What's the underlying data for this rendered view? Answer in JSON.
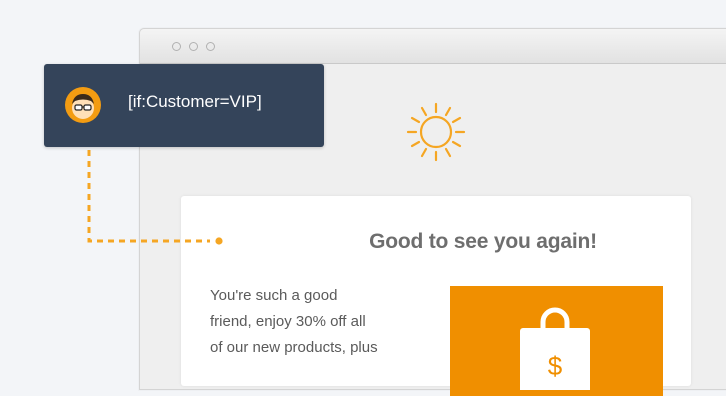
{
  "condition_tag": {
    "text": "[if:Customer=VIP]",
    "avatar_icon": "person-glasses-avatar-icon"
  },
  "email": {
    "heading": "Good to see you again!",
    "body_lines": [
      "You're such a good",
      "friend, enjoy 30% off all",
      "of our new products, plus"
    ],
    "hero_icon": "sun-icon",
    "promo_icon": "shopping-bag-dollar-icon",
    "promo_symbol": "$"
  },
  "colors": {
    "accent": "#f08f00",
    "tag_background": "#34445a",
    "heading": "#6e6e6e",
    "body_text": "#5a5a5a",
    "page_background": "#f3f5f8"
  }
}
